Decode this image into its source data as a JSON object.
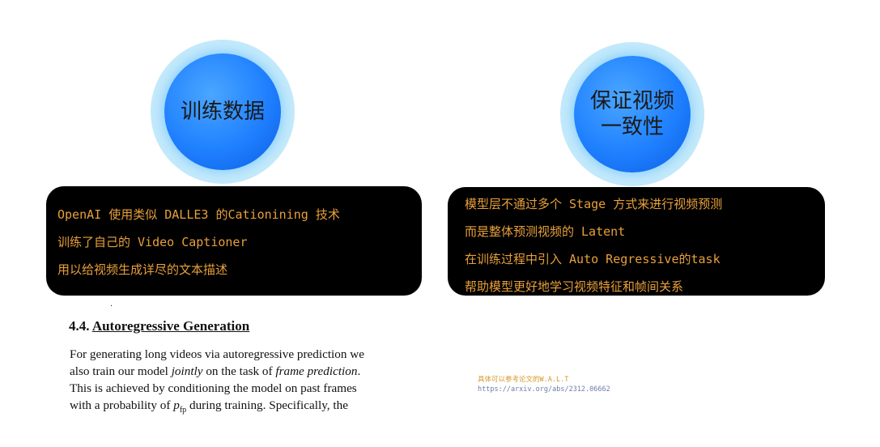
{
  "circles": {
    "left": {
      "lines": [
        "训练数据"
      ]
    },
    "right": {
      "lines": [
        "保证视频",
        "一致性"
      ]
    }
  },
  "boxes": {
    "left": {
      "lines": [
        "OpenAI 使用类似 DALLE3 的Cationining 技术",
        "训练了自己的 Video Captioner",
        "用以给视频生成详尽的文本描述"
      ]
    },
    "right": {
      "lines": [
        "模型层不通过多个 Stage 方式来进行视频预测",
        "而是整体预测视频的 Latent",
        "在训练过程中引入 Auto Regressive的task",
        "帮助模型更好地学习视频特征和帧间关系"
      ]
    }
  },
  "paper": {
    "stray_mark": "·",
    "section_number": "4.4.",
    "section_title": "Autoregressive Generation",
    "paragraph": {
      "line1": "For generating long videos via autoregressive prediction we",
      "line2_a": "also train our model ",
      "line2_em": "jointly",
      "line2_b": " on the task of ",
      "line2_em2": "frame prediction",
      "line2_c": ".",
      "line3": "This is achieved by conditioning the model on past frames",
      "line4_a": "with a probability of ",
      "line4_var": "p",
      "line4_sub": "fp",
      "line4_b": " during training.  Specifically, the"
    }
  },
  "reference": {
    "note": "具体可以参考论文的W.A.L.T",
    "url": "https://arxiv.org/abs/2312.06662"
  },
  "colors": {
    "box_text": "#e8a03a",
    "box_background": "#000000",
    "circle_fill": "#1f80ff",
    "circle_halo": "#bfe7fb",
    "reference_note": "#d49a2a",
    "reference_url": "#6b7fa8"
  }
}
